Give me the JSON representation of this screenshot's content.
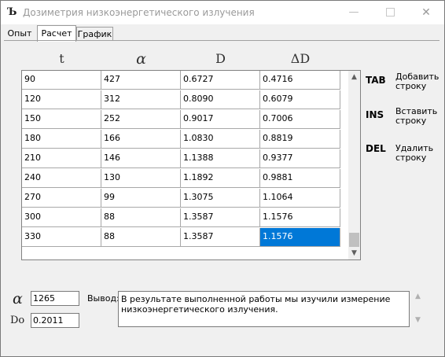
{
  "window": {
    "title": "Дозиметрия низкоэнергетического излучения",
    "close_glyph": "✕",
    "min_glyph": "—"
  },
  "tabs": [
    {
      "label": "Опыт"
    },
    {
      "label": "Расчет"
    },
    {
      "label": "График"
    }
  ],
  "table": {
    "headers": [
      "t",
      "α",
      "D",
      "ΔD"
    ],
    "rows": [
      [
        "90",
        "427",
        "0.6727",
        "0.4716"
      ],
      [
        "120",
        "312",
        "0.8090",
        "0.6079"
      ],
      [
        "150",
        "252",
        "0.9017",
        "0.7006"
      ],
      [
        "180",
        "166",
        "1.0830",
        "0.8819"
      ],
      [
        "210",
        "146",
        "1.1388",
        "0.9377"
      ],
      [
        "240",
        "130",
        "1.1892",
        "0.9881"
      ],
      [
        "270",
        "99",
        "1.3075",
        "1.1064"
      ],
      [
        "300",
        "88",
        "1.3587",
        "1.1576"
      ],
      [
        "330",
        "88",
        "1.3587",
        "1.1576"
      ]
    ],
    "selected_cell": [
      8,
      3
    ]
  },
  "keys": [
    {
      "key": "TAB",
      "desc": "Добавить строку"
    },
    {
      "key": "INS",
      "desc": "Вставить строку"
    },
    {
      "key": "DEL",
      "desc": "Удалить строку"
    }
  ],
  "results": {
    "alpha_symbol": "α",
    "alpha_value": "1265",
    "do_symbol": "Do",
    "do_value": "0.2011",
    "conclusion_label": "Вывод:",
    "conclusion_text": "В результате выполненной работы мы изучили измерение\nнизкоэнергетического излучения."
  },
  "colors": {
    "selection": "#0078d7",
    "window_bg": "#f0f0f0"
  },
  "icons": {
    "app": "dosimeter-app-icon",
    "scroll_up": "chevron-up-icon",
    "scroll_down": "chevron-down-icon"
  }
}
